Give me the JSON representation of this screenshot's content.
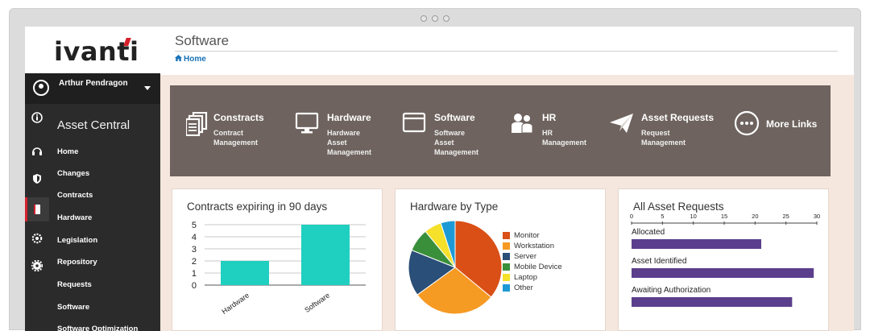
{
  "brand": {
    "logo_text": "ivanti"
  },
  "user": {
    "name": "Arthur Pendragon"
  },
  "sidebar": {
    "section": "Asset Central",
    "items": [
      {
        "label": "Home"
      },
      {
        "label": "Changes"
      },
      {
        "label": "Contracts"
      },
      {
        "label": "Hardware"
      },
      {
        "label": "Legislation"
      },
      {
        "label": "Repository"
      },
      {
        "label": "Requests"
      },
      {
        "label": "Software"
      },
      {
        "label": "Software Optimization"
      }
    ]
  },
  "header": {
    "title": "Software",
    "breadcrumb": "Home"
  },
  "quick_links": [
    {
      "title": "Constracts",
      "subtitle": "Contract\nManagement",
      "icon": "documents-icon"
    },
    {
      "title": "Hardware",
      "subtitle": "Hardware Asset\nManagement",
      "icon": "monitor-icon"
    },
    {
      "title": "Software",
      "subtitle": "Software Asset\nManagement",
      "icon": "window-icon"
    },
    {
      "title": "HR",
      "subtitle": "HR Management",
      "icon": "people-icon"
    },
    {
      "title": "Asset Requests",
      "subtitle": "Request Management",
      "icon": "paper-plane-icon"
    },
    {
      "title": "More Links",
      "subtitle": "",
      "icon": "more-icon"
    }
  ],
  "cards": {
    "contracts": {
      "title": "Contracts expiring in 90 days"
    },
    "hardware": {
      "title": "Hardware by Type"
    },
    "requests": {
      "title": "All Asset Requests"
    }
  },
  "colors": {
    "bar_teal": "#1fcfbf",
    "bar_purple": "#5b3f8c",
    "monitor": "#d94f16",
    "workstation": "#f59a23",
    "server": "#2a4f78",
    "mobile_device": "#3a8f3a",
    "laptop": "#f5e02a",
    "other": "#1d9ad6"
  },
  "chart_data": [
    {
      "type": "bar",
      "title": "Contracts expiring in 90 days",
      "categories": [
        "Hardware",
        "Software"
      ],
      "values": [
        2,
        5
      ],
      "ylim": [
        0,
        5
      ],
      "yticks": [
        0,
        1,
        2,
        3,
        4,
        5
      ]
    },
    {
      "type": "pie",
      "title": "Hardware by Type",
      "labels": [
        "Monitor",
        "Workstation",
        "Server",
        "Mobile Device",
        "Laptop",
        "Other"
      ],
      "values": [
        36,
        29,
        16,
        8,
        6,
        5
      ],
      "legend": "right"
    },
    {
      "type": "bar",
      "orientation": "horizontal",
      "title": "All Asset Requests",
      "categories": [
        "Allocated",
        "Asset Identified",
        "Awaiting Authorization"
      ],
      "values": [
        21,
        29.5,
        26
      ],
      "xlim": [
        0,
        30
      ],
      "xticks": [
        0,
        5,
        10,
        15,
        20,
        25,
        30
      ]
    }
  ]
}
